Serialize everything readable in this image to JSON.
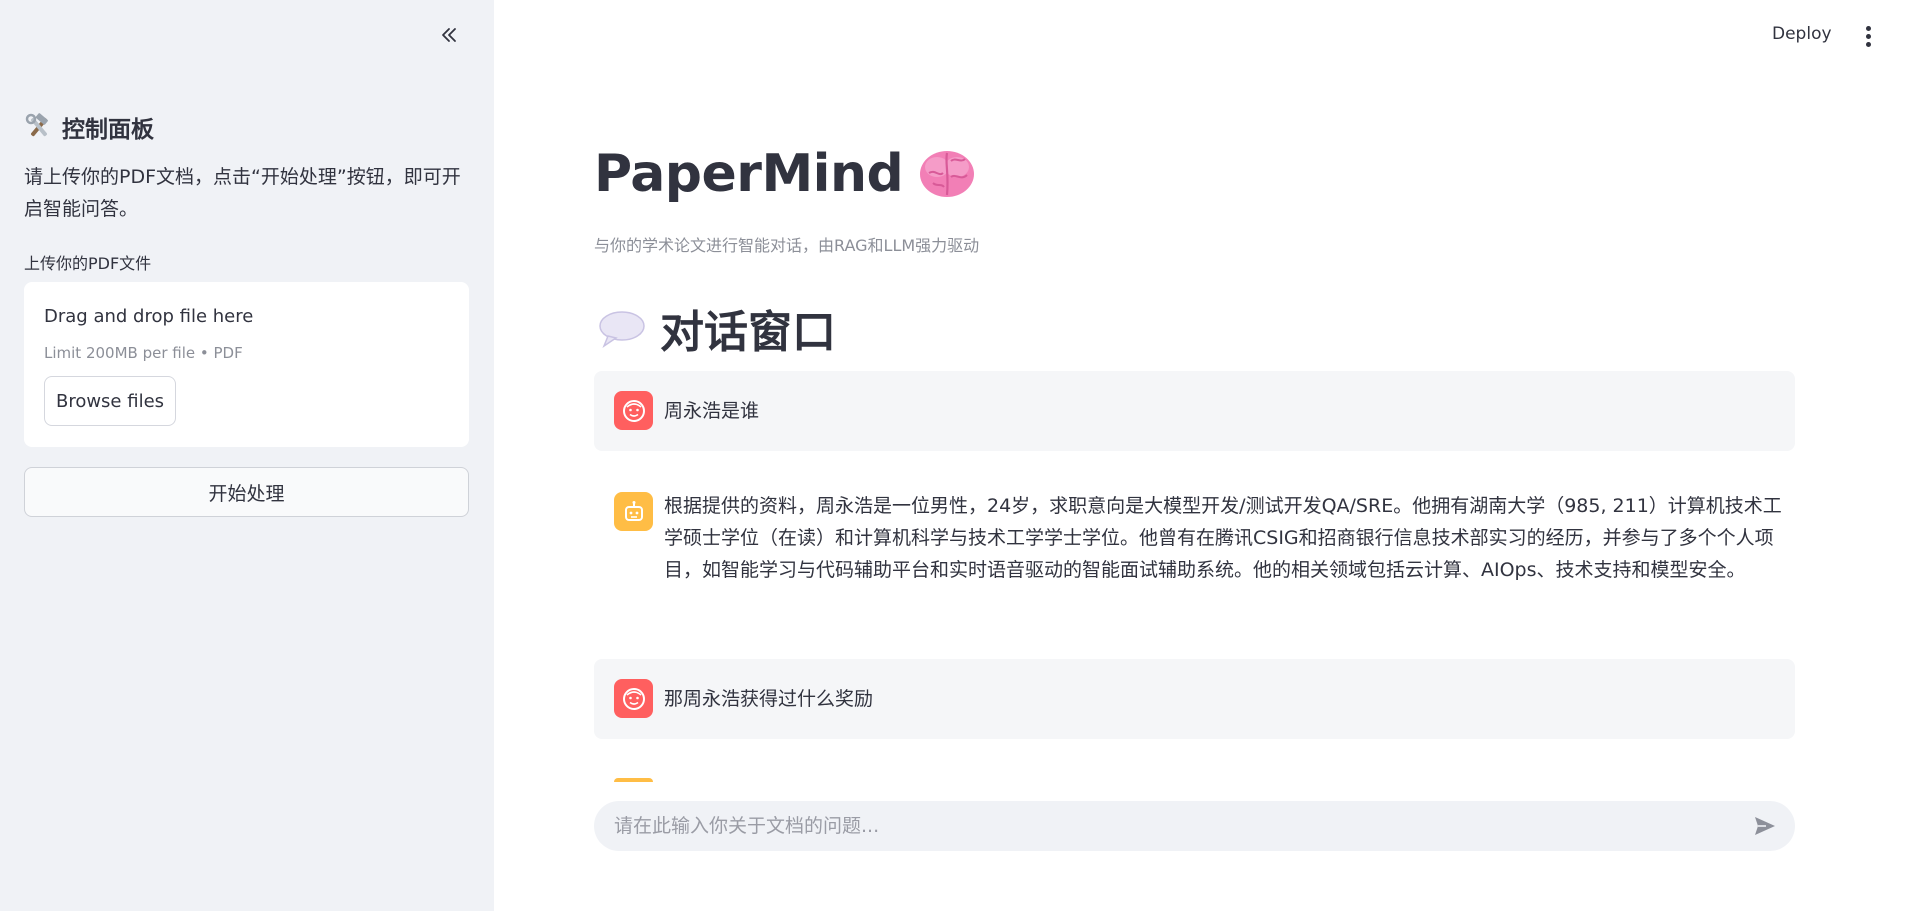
{
  "sidebar": {
    "title_icon": "hammer-wrench-icon",
    "title": "控制面板",
    "description": "请上传你的PDF文档，点击“开始处理”按钮，即可开启智能问答。",
    "upload_label": "上传你的PDF文件",
    "dropzone": {
      "title": "Drag and drop file here",
      "limit": "Limit 200MB per file • PDF",
      "browse_label": "Browse files"
    },
    "start_button": "开始处理"
  },
  "topbar": {
    "deploy_label": "Deploy"
  },
  "main": {
    "title": "PaperMind",
    "title_icon": "brain-icon",
    "subtitle": "与你的学术论文进行智能对话，由RAG和LLM强力驱动",
    "chat_heading": "对话窗口",
    "chat_heading_icon": "speech-bubble-icon",
    "messages": [
      {
        "role": "user",
        "text": "周永浩是谁"
      },
      {
        "role": "assistant",
        "text": "根据提供的资料，周永浩是一位男性，24岁，求职意向是大模型开发/测试开发QA/SRE。他拥有湖南大学（985, 211）计算机技术工学硕士学位（在读）和计算机科学与技术工学学士学位。他曾有在腾讯CSIG和招商银行信息技术部实习的经历，并参与了多个个人项目，如智能学习与代码辅助平台和实时语音驱动的智能面试辅助系统。他的相关领域包括云计算、AIOps、技术支持和模型安全。"
      },
      {
        "role": "user",
        "text": "那周永浩获得过什么奖励"
      }
    ],
    "chat_input_placeholder": "请在此输入你关于文档的问题..."
  },
  "colors": {
    "sidebar_bg": "#f0f2f6",
    "user_avatar": "#ff5f5f",
    "bot_avatar": "#ffbd45",
    "user_msg_bg": "#f5f6f8"
  }
}
